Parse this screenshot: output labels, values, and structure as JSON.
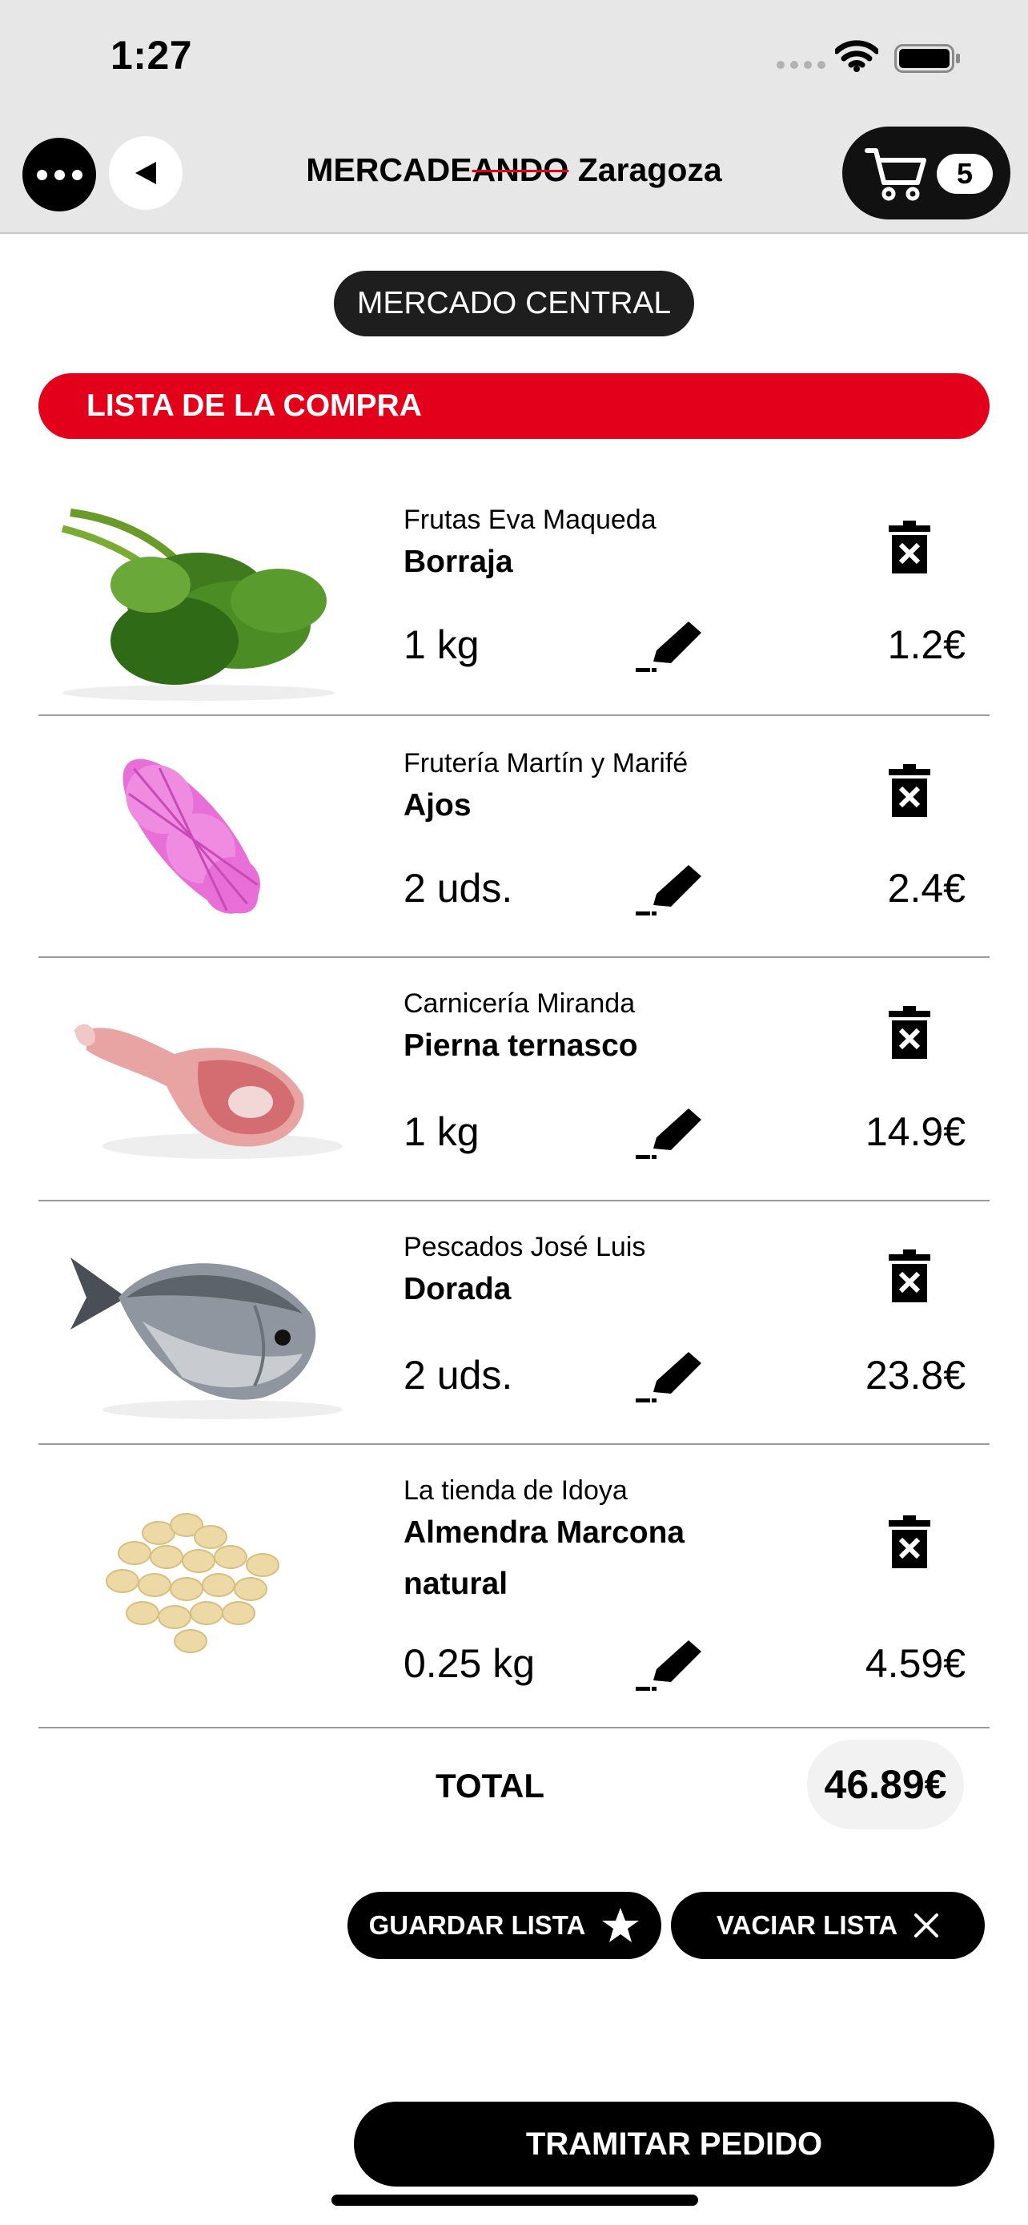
{
  "status_bar": {
    "time": "1:27"
  },
  "header": {
    "title_prefix": "MERCADE",
    "title_strike": "ANDO",
    "title_suffix": " Zaragoza",
    "cart_count": "5"
  },
  "market": "MERCADO CENTRAL",
  "list_title": "LISTA DE LA COMPRA",
  "items": [
    {
      "shop": "Frutas Eva Maqueda",
      "name": "Borraja",
      "qty": "1 kg",
      "price": "1.2€"
    },
    {
      "shop": "Frutería Martín y Marifé",
      "name": "Ajos",
      "qty": "2 uds.",
      "price": "2.4€"
    },
    {
      "shop": "Carnicería Miranda",
      "name": "Pierna ternasco",
      "qty": "1 kg",
      "price": "14.9€"
    },
    {
      "shop": "Pescados José Luis",
      "name": "Dorada",
      "qty": "2 uds.",
      "price": "23.8€"
    },
    {
      "shop": "La tienda de Idoya",
      "name": "Almendra Marcona natural",
      "qty": "0.25 kg",
      "price": "4.59€"
    }
  ],
  "total": {
    "label": "TOTAL",
    "value": "46.89€"
  },
  "actions": {
    "save": "GUARDAR LISTA",
    "clear": "VACIAR LISTA"
  },
  "checkout": "TRAMITAR PEDIDO",
  "colors": {
    "accent": "#e2001a",
    "dark": "#000000",
    "header_bg": "#e7e7e7"
  }
}
